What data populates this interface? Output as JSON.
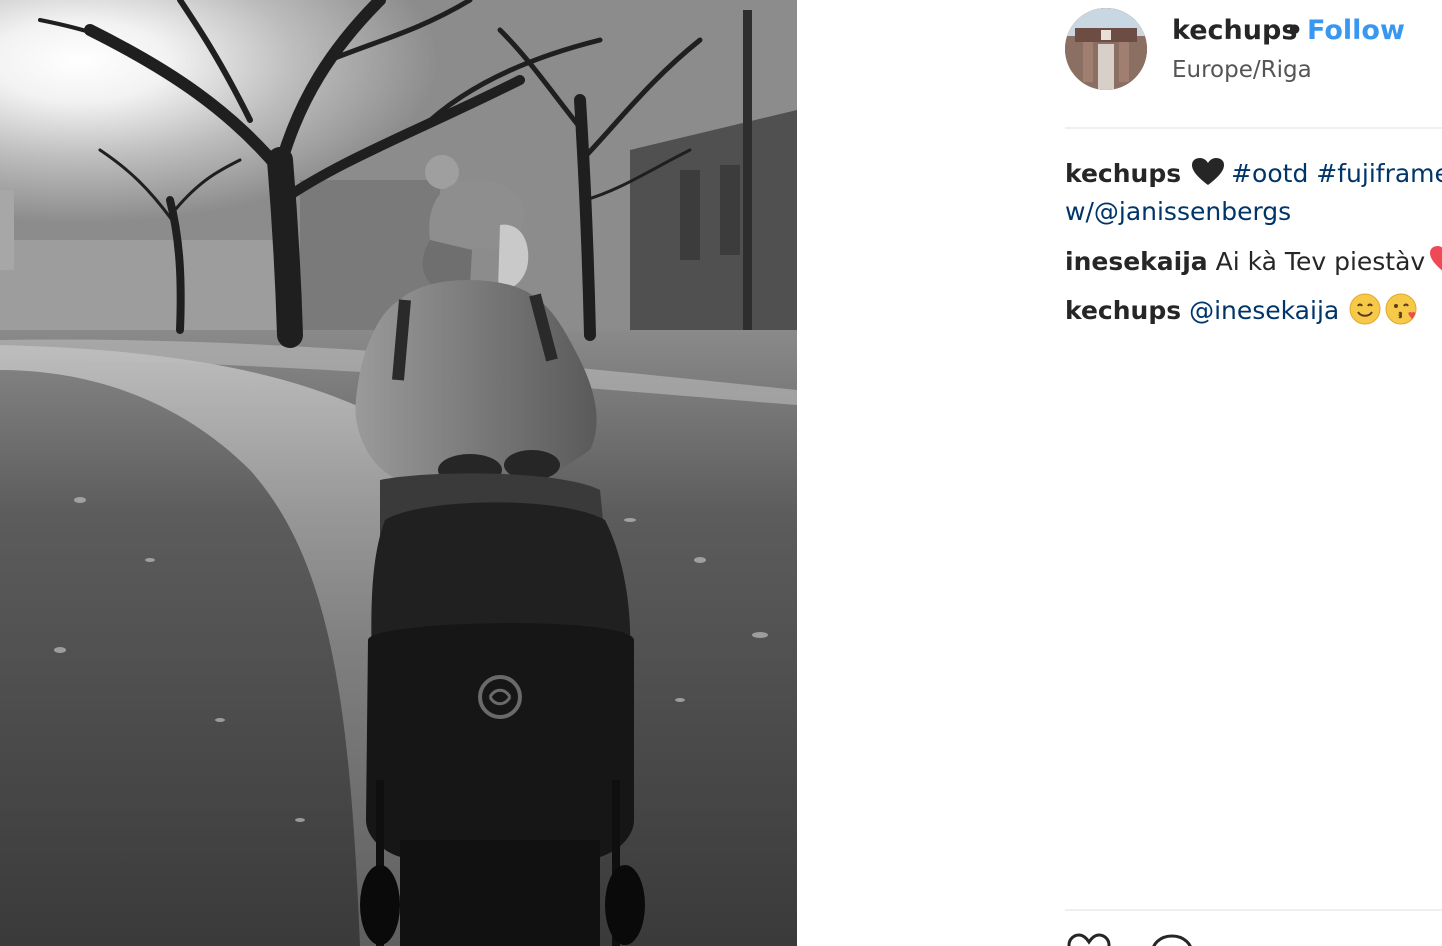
{
  "post": {
    "username": "kechups",
    "separator": "•",
    "follow_label": "Follow",
    "location": "Europe/Riga",
    "photo_icon": "stroller-logo-icon"
  },
  "comments": [
    {
      "username": "kechups",
      "icon": "black-heart-icon",
      "tags": [
        "#ootd",
        "#fujiframe"
      ],
      "second_line": "w/@janissenbergs"
    },
    {
      "username": "inesekaija",
      "text": "Ai kà Tev piestàv",
      "icon": "red-heart-icon"
    },
    {
      "username": "kechups",
      "mention": "@inesekaija",
      "icons": [
        "smiling-face-icon",
        "kissing-face-icon"
      ]
    }
  ],
  "actions": {
    "icons": [
      "like-heart-icon",
      "comment-bubble-icon"
    ]
  },
  "colors": {
    "follow": "#3897f0",
    "link": "#003569",
    "text": "#262626",
    "divider": "#efefef",
    "heart_red": "#ed4956"
  }
}
